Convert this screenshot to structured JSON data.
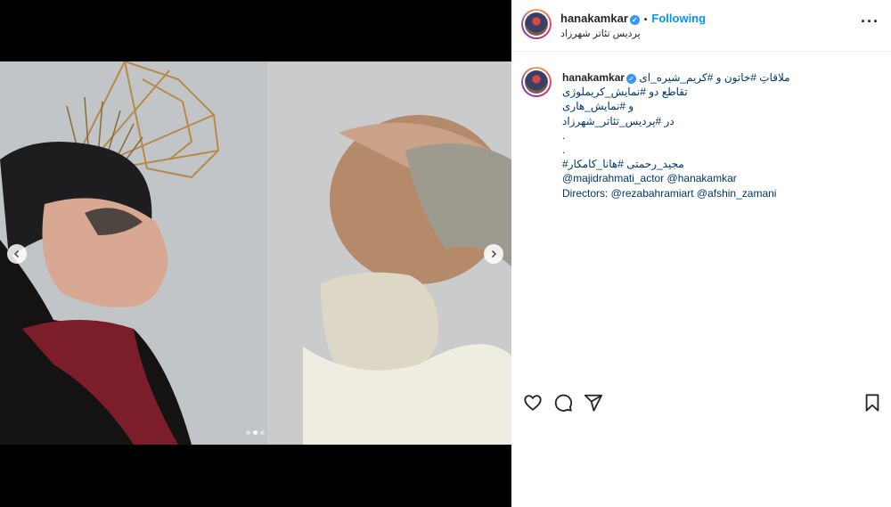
{
  "post": {
    "username": "hanakamkar",
    "separator": "•",
    "follow_status": "Following",
    "location": "پردیس تئاتر شهرزاد",
    "more_label": "···"
  },
  "media": {
    "current_index": 2,
    "total": 3
  },
  "caption": {
    "username": "hanakamkar",
    "lines": [
      "ملاقاتِ #خاتون و #کریم_شیره_ای",
      "تقاطع دو #نمایش_کریملوژی",
      "و #نمایش_هاری",
      "در #پردیس_تئاتر_شهرزاد",
      ".",
      ".",
      "مجید_رحمتی #هانا_کامکار#",
      "@majidrahmati_actor @hanakamkar",
      "Directors: @rezabahramiart @afshin_zamani"
    ]
  },
  "icons": {
    "like": "heart-icon",
    "comment": "comment-icon",
    "share": "share-icon",
    "save": "bookmark-icon",
    "prev": "chevron-left-icon",
    "next": "chevron-right-icon",
    "verified": "verified-badge-icon"
  },
  "colors": {
    "link": "#0095f6",
    "tag": "#00376b",
    "verified": "#3897f0"
  }
}
